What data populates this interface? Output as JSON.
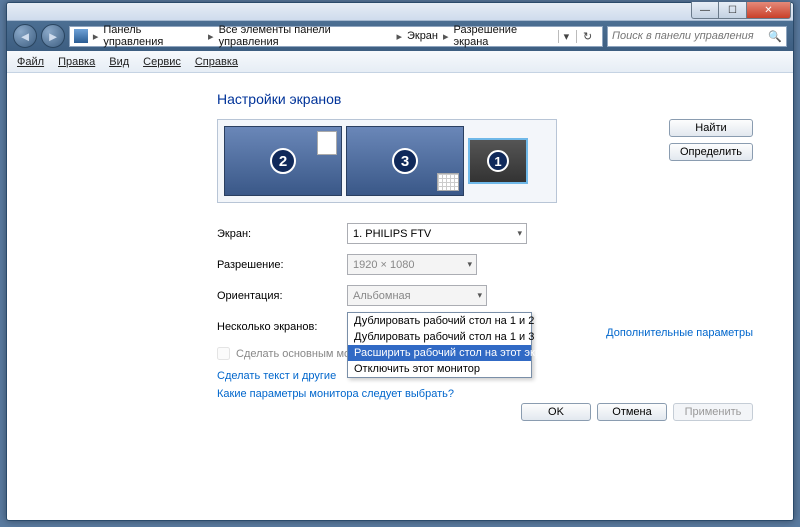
{
  "breadcrumb": {
    "items": [
      "Панель управления",
      "Все элементы панели управления",
      "Экран",
      "Разрешение экрана"
    ]
  },
  "search": {
    "placeholder": "Поиск в панели управления"
  },
  "menu": {
    "file": "Файл",
    "edit": "Правка",
    "view": "Вид",
    "tools": "Сервис",
    "help": "Справка"
  },
  "heading": "Настройки экранов",
  "side": {
    "find": "Найти",
    "identify": "Определить"
  },
  "monitors": {
    "m1": "1",
    "m2": "2",
    "m3": "3"
  },
  "labels": {
    "screen": "Экран:",
    "resolution": "Разрешение:",
    "orientation": "Ориентация:",
    "multiple": "Несколько экранов:",
    "makeMain": "Сделать основным монитором"
  },
  "values": {
    "screen": "1. PHILIPS FTV",
    "resolution": "1920 × 1080",
    "orientation": "Альбомная",
    "multiple": "Отключить этот монитор"
  },
  "dropdown": {
    "opt1": "Дублировать рабочий стол на 1 и 2",
    "opt2": "Дублировать рабочий стол на 1 и 3",
    "opt3": "Расширить рабочий стол на этот экран",
    "opt4": "Отключить этот монитор"
  },
  "links": {
    "advanced": "Дополнительные параметры",
    "textSize": "Сделать текст и другие",
    "whichMonitor": "Какие параметры монитора следует выбрать?"
  },
  "buttons": {
    "ok": "OK",
    "cancel": "Отмена",
    "apply": "Применить"
  }
}
